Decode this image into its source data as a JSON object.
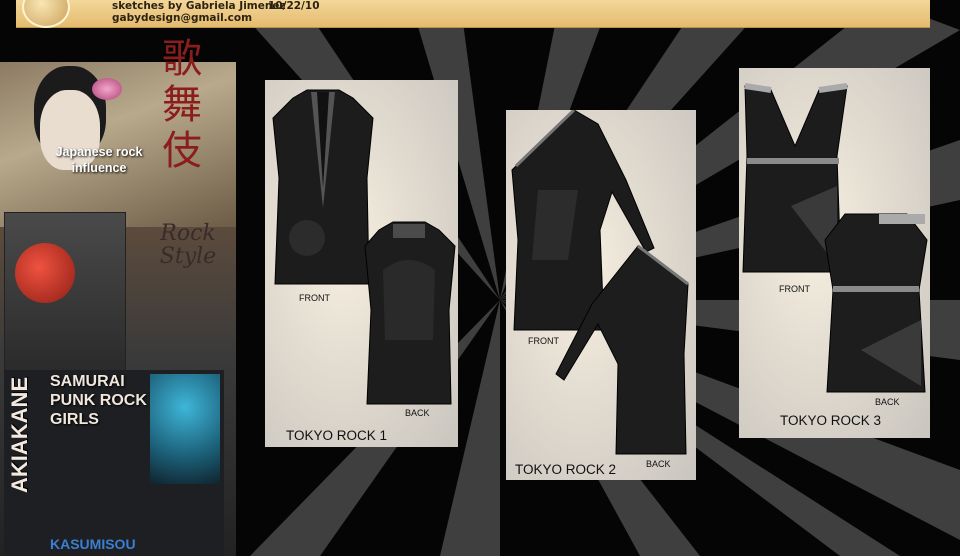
{
  "header": {
    "credit": "sketches by Gabriela Jimenez",
    "date": "10/22/10",
    "email": "gabydesign@gmail.com"
  },
  "moodboard": {
    "kanji": "歌舞伎",
    "rock_style": "Rock Style",
    "japanese_rock": "Japanese rock influence",
    "vertical_word": "AKIAKANE",
    "samurai_line1": "SAMURAI",
    "samurai_line2": "PUNK ROCK",
    "samurai_line3": "GIRLS",
    "bottom_word": "KASUMISOU"
  },
  "designs": [
    {
      "title": "TOKYO ROCK 1",
      "front": "FRONT",
      "back": "BACK"
    },
    {
      "title": "TOKYO ROCK 2",
      "front": "FRONT",
      "back": "BACK"
    },
    {
      "title": "TOKYO ROCK 3",
      "front": "FRONT",
      "back": "BACK"
    }
  ],
  "colors": {
    "header": "#e9c47c",
    "background": "#050505",
    "dress": "#1a1a1a"
  }
}
